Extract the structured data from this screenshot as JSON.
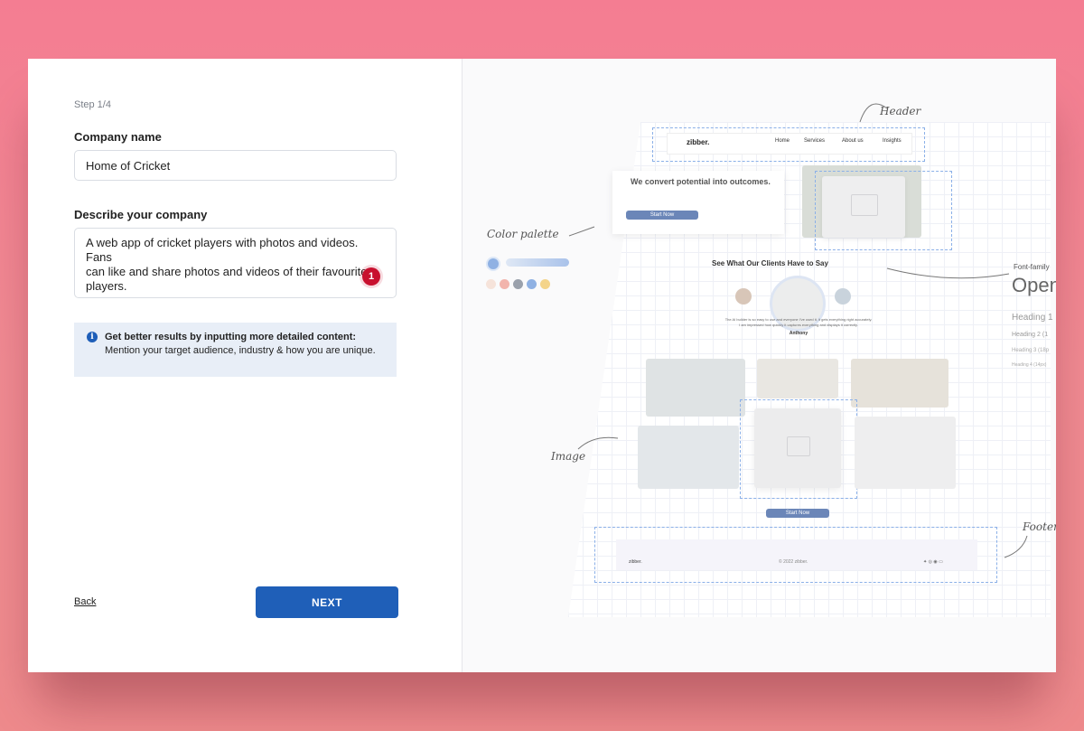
{
  "form": {
    "step": "Step 1/4",
    "company_label": "Company name",
    "company_value": "Home of Cricket",
    "describe_label": "Describe your company",
    "describe_line1": "A web app of cricket players with photos and videos. Fans",
    "describe_line2": "can like and share photos and videos of their favourite",
    "describe_line3": "players.",
    "badge_count": "1",
    "info_title": "Get better results by inputting more detailed content:",
    "info_body": "Mention your target audience, industry & how you are unique.",
    "back_label": "Back",
    "next_label": "NEXT"
  },
  "preview": {
    "annotations": {
      "header": "Header",
      "color_palette": "Color palette",
      "font_family": "Font-family",
      "image": "Image",
      "footer": "Footer"
    },
    "font_sample": "Open",
    "heading_samples": [
      "Heading 1",
      "Heading 2 (1",
      "Heading 3 (18p",
      "Heading 4 (14px)"
    ],
    "logo": "zibber.",
    "nav": [
      "Home",
      "Services",
      "About us",
      "Insights"
    ],
    "hero_title": "We convert potential into outcomes.",
    "hero_button": "Start Now",
    "testimonials_title": "See What Our Clients Have to Say",
    "testimonial_quote_1": "The AI builder is so easy to use and everyone I've used it, it gets everything right accurately.",
    "testimonial_quote_2": "I am impressed how quickly it captures everything and displays it correctly.",
    "testimonial_author": "Anthony",
    "gallery_button": "Start Now",
    "footer_logo": "zibber.",
    "footer_copyright": "© 2022 zibber.",
    "swatch_colors": [
      "#f6e3da",
      "#f2b4ac",
      "#9aa1ac",
      "#8fb1e3",
      "#f4d48a"
    ],
    "colors": {
      "primary": "#1f5fb8",
      "badge": "#c8102e",
      "info_bg": "#e8eef7"
    }
  }
}
